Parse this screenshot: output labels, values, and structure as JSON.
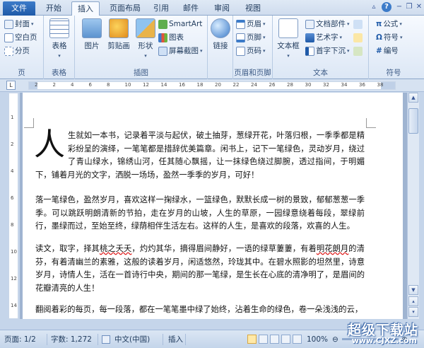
{
  "tabs": {
    "file": "文件",
    "items": [
      {
        "label": "开始",
        "active": false
      },
      {
        "label": "插入",
        "active": true
      },
      {
        "label": "页面布局",
        "active": false
      },
      {
        "label": "引用",
        "active": false
      },
      {
        "label": "邮件",
        "active": false
      },
      {
        "label": "审阅",
        "active": false
      },
      {
        "label": "视图",
        "active": false
      }
    ]
  },
  "ribbon": {
    "pages": {
      "cover": "封面",
      "blank": "空白页",
      "break": "分页",
      "label": "页"
    },
    "tables": {
      "table": "表格",
      "label": "表格"
    },
    "illustrations": {
      "picture": "图片",
      "clipart": "剪贴画",
      "shapes": "形状",
      "smartart": "SmartArt",
      "chart": "图表",
      "screenshot": "屏幕截图",
      "label": "插图"
    },
    "links": {
      "link": "链接"
    },
    "header_footer": {
      "header": "页眉",
      "footer": "页脚",
      "page_number": "页码",
      "label": "页眉和页脚"
    },
    "text": {
      "textbox": "文本框",
      "docparts": "文档部件",
      "wordart": "艺术字",
      "dropcap": "首字下沉",
      "label": "文本"
    },
    "symbols": {
      "equation": "公式",
      "symbol": "符号",
      "numbering": "编号",
      "label": "符号"
    }
  },
  "ruler": {
    "corner": "L",
    "numbers": [
      "2",
      "2",
      "4",
      "6",
      "8",
      "10",
      "12",
      "14",
      "16",
      "18",
      "20",
      "22",
      "24",
      "26",
      "28",
      "30",
      "32",
      "34",
      "36",
      "38"
    ],
    "vnumbers": [
      "1",
      "2",
      "4",
      "6",
      "8",
      "10",
      "12",
      "14"
    ]
  },
  "document": {
    "dropcap_char": "人",
    "p1": "生就如一本书，记录着平淡与起伏，破土抽芽，葱绿开花，叶落归根，一季季都是精彩纷呈的演绎，一笔笔都是措辞优美篇章。闲书上，记下一笔绿色，灵动岁月，绕过了青山绿水，锦绣山河，任其随心飘摇，让一抹绿色绕过脚腕，透过指间，于明媚下，铺着月光的文字，洒脱一场场，盈然一季季的岁月，可好！",
    "p2": "落一笔绿色，盈然岁月，喜欢这样一掬绿水，一篮绿色，默默长成一树的景致，郁郁葱葱一季季。可以跳跃明朗清新的节拍，走在岁月的山坡，人生的草原，一园绿意绕着每段，翠绿前行，墨绿而过，至始至终，绿荫相伴生活左右。这样的人生，是喜欢的段落，欢喜的人生。",
    "p3_a": "读文，取字，择其",
    "p3_u1": "桃之夭夭",
    "p3_b": "，灼灼其华，摘得眉间静好，一语的绿草萋萋，有着",
    "p3_u2": "明花朗月",
    "p3_c": "的清芬，有着清幽兰的素雅，这般的读着岁月，闲适悠然，玲珑其中。在碧水照影的坦然里，诗意岁月，诗情人生，活在一首诗行中央，期间的那一笔绿，是生长在心底的清净明了，是眉间的花瓣清亮的人生！",
    "p4": "翻阅着彩的每页，每一段落，都在一笔笔墨中绿了始终，沾着生命的绿色，卷一朵浅浅的云，"
  },
  "statusbar": {
    "page": "页面: 1/2",
    "words": "字数: 1,272",
    "language": "中文(中国)",
    "insert": "插入",
    "zoom": "100%"
  },
  "watermark": {
    "title": "超级下载站",
    "url": "www.CJXZ.com"
  },
  "colors": {
    "accent": "#1f5aa8",
    "ribbon_bg": "#dce7f5",
    "spell_underline": "#dd1111"
  }
}
